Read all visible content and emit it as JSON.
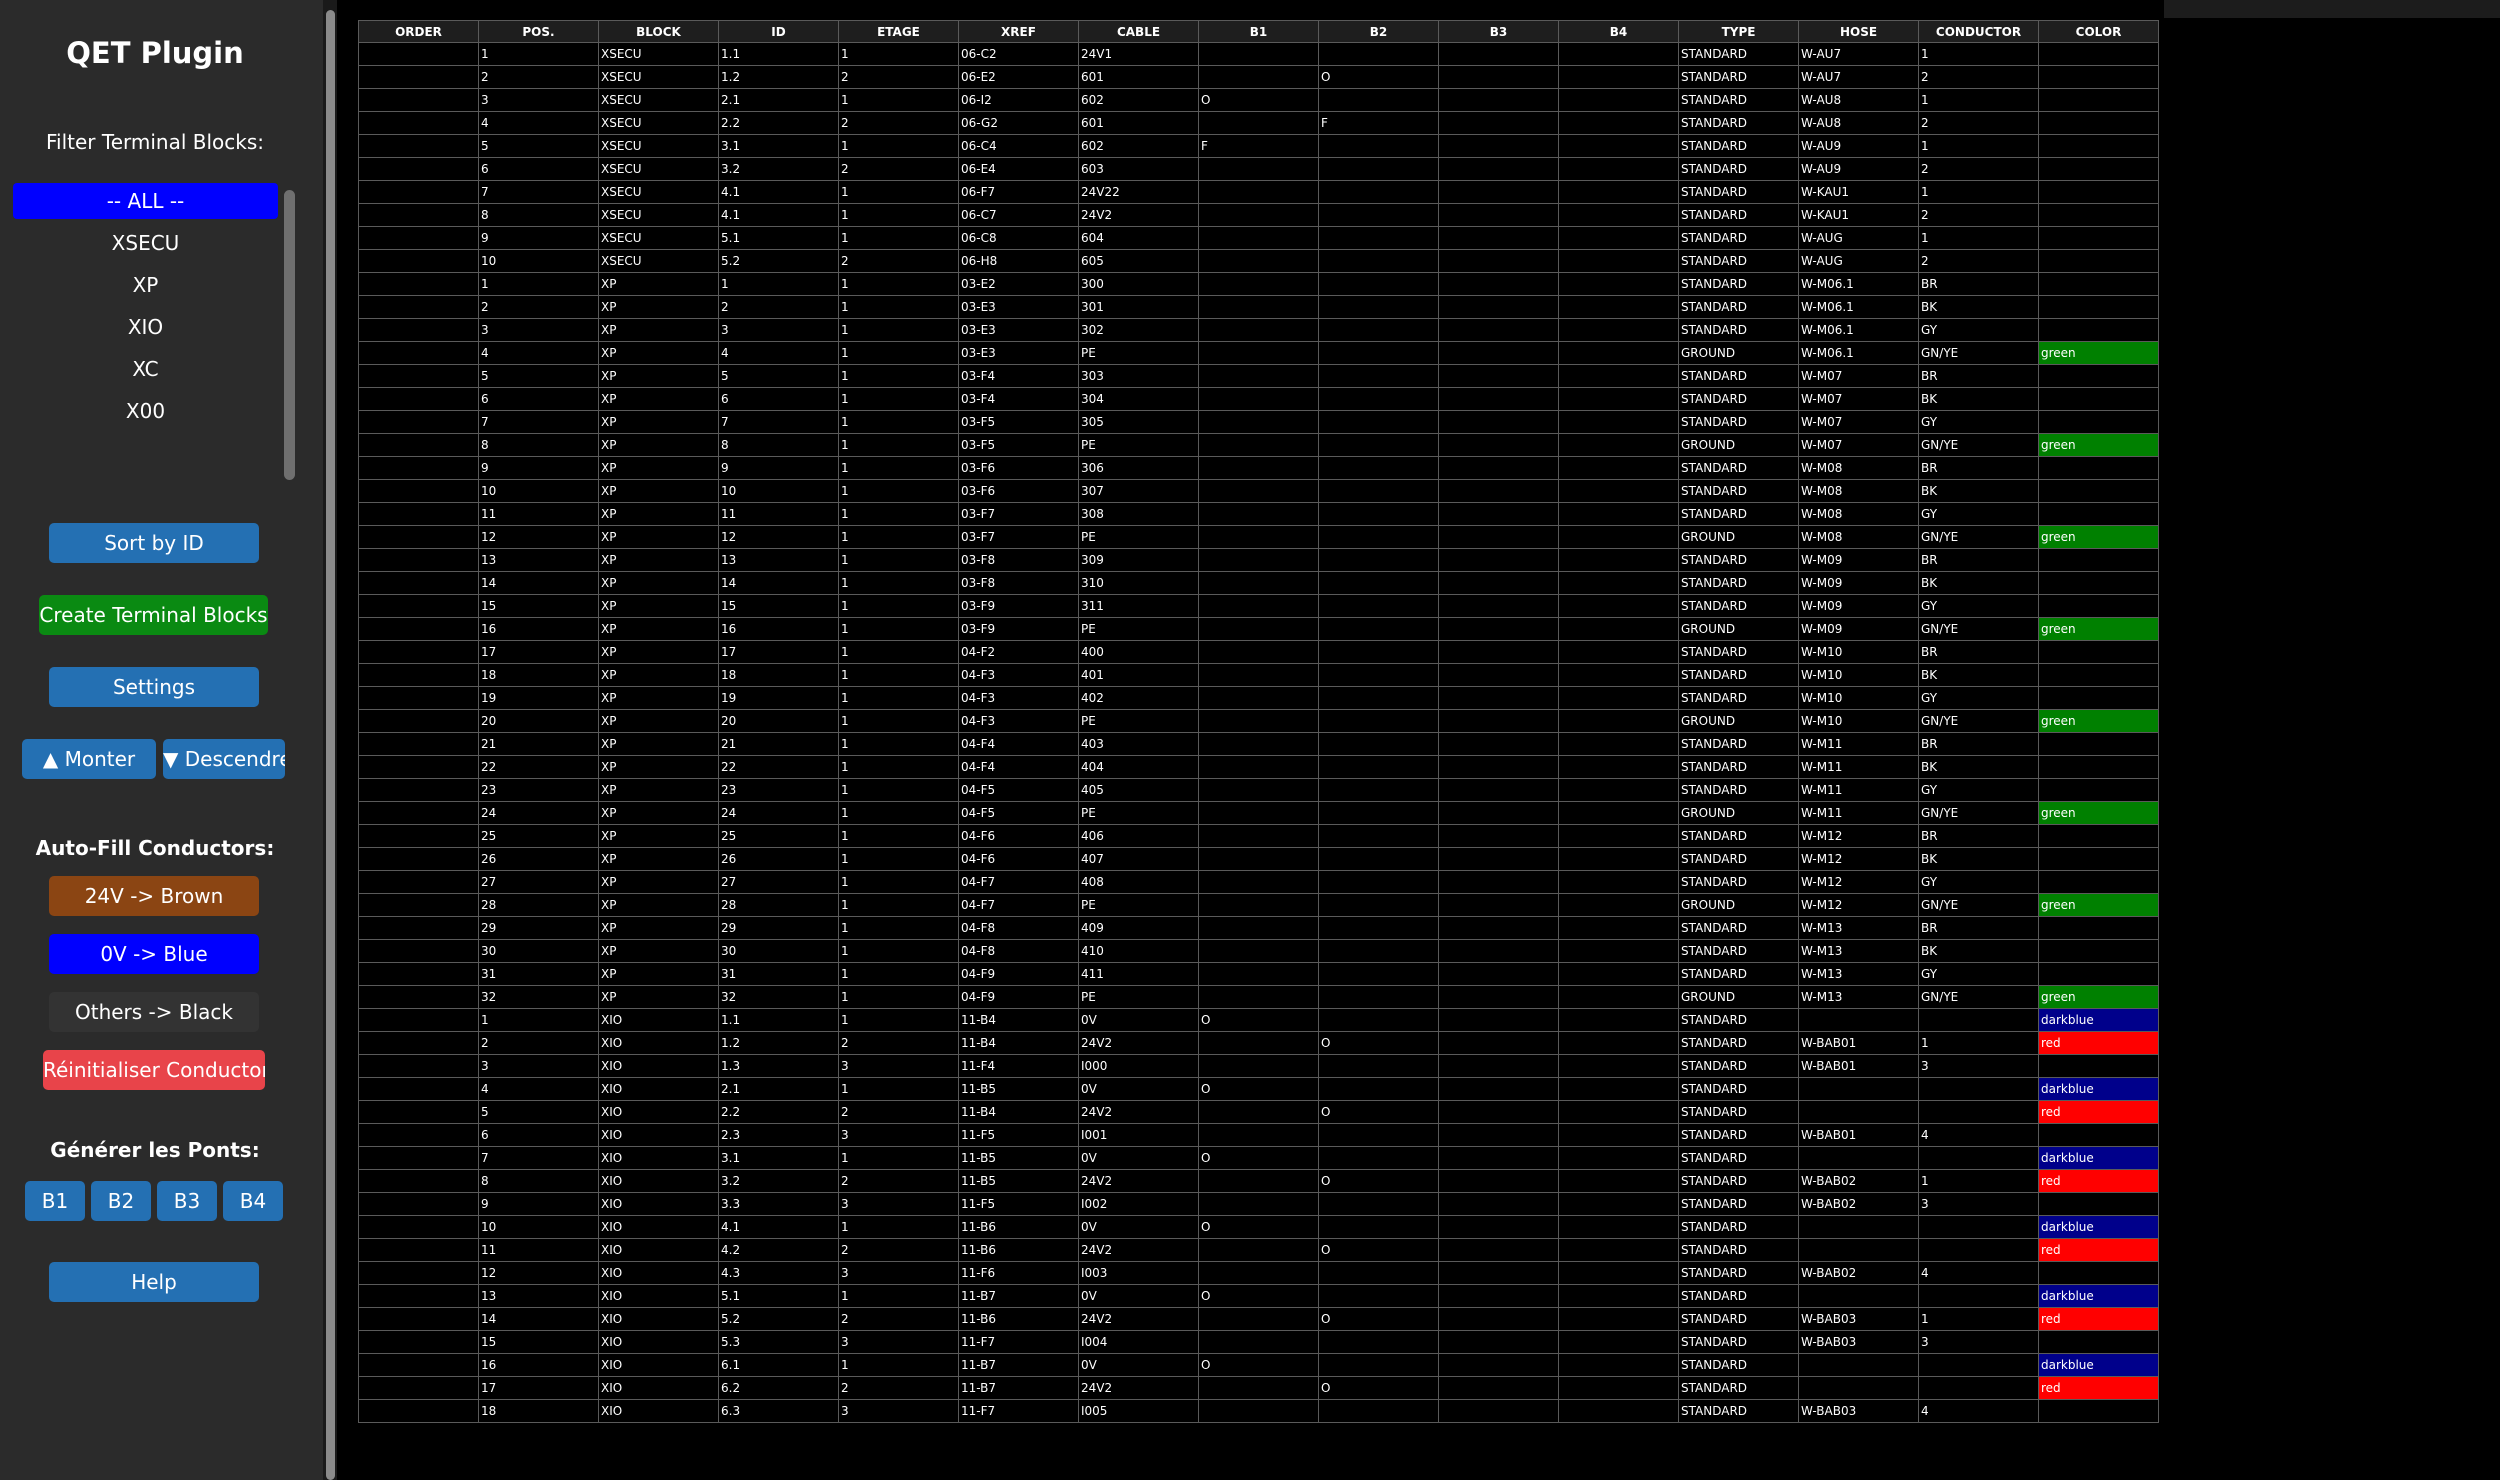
{
  "sidebar": {
    "title": "QET Plugin",
    "filter_label": "Filter Terminal Blocks:",
    "filter_items": [
      "-- ALL --",
      "XSECU",
      "XP",
      "XIO",
      "XC",
      "X00"
    ],
    "selected_filter": "-- ALL --",
    "sort_button": "Sort by ID",
    "create_button": "Create Terminal Blocks",
    "settings_button": "Settings",
    "up_button": "▲ Monter",
    "down_button": "▼ Descendre",
    "autofill_label": "Auto-Fill Conductors:",
    "autofill_24v": "24V -> Brown",
    "autofill_0v": "0V -> Blue",
    "autofill_others": "Others -> Black",
    "reset_conductor": "Réinitialiser Conductor",
    "bridges_label": "Générer les Ponts:",
    "bridge_buttons": [
      "B1",
      "B2",
      "B3",
      "B4"
    ],
    "help_button": "Help"
  },
  "colors": {
    "green": "#008000",
    "darkblue": "#00008b",
    "red": "#ff0000",
    "sidebar_bg": "#2b2b2b",
    "button_blue": "#2470b3"
  },
  "table": {
    "columns": [
      "ORDER",
      "POS.",
      "BLOCK",
      "ID",
      "ETAGE",
      "XREF",
      "CABLE",
      "B1",
      "B2",
      "B3",
      "B4",
      "TYPE",
      "HOSE",
      "CONDUCTOR",
      "COLOR"
    ],
    "rows": [
      [
        "",
        "1",
        "XSECU",
        "1.1",
        "1",
        "06-C2",
        "24V1",
        "",
        "",
        "",
        "",
        "STANDARD",
        "W-AU7",
        "1",
        ""
      ],
      [
        "",
        "2",
        "XSECU",
        "1.2",
        "2",
        "06-E2",
        "601",
        "",
        "O",
        "",
        "",
        "STANDARD",
        "W-AU7",
        "2",
        ""
      ],
      [
        "",
        "3",
        "XSECU",
        "2.1",
        "1",
        "06-I2",
        "602",
        "O",
        "",
        "",
        "",
        "STANDARD",
        "W-AU8",
        "1",
        ""
      ],
      [
        "",
        "4",
        "XSECU",
        "2.2",
        "2",
        "06-G2",
        "601",
        "",
        "F",
        "",
        "",
        "STANDARD",
        "W-AU8",
        "2",
        ""
      ],
      [
        "",
        "5",
        "XSECU",
        "3.1",
        "1",
        "06-C4",
        "602",
        "F",
        "",
        "",
        "",
        "STANDARD",
        "W-AU9",
        "1",
        ""
      ],
      [
        "",
        "6",
        "XSECU",
        "3.2",
        "2",
        "06-E4",
        "603",
        "",
        "",
        "",
        "",
        "STANDARD",
        "W-AU9",
        "2",
        ""
      ],
      [
        "",
        "7",
        "XSECU",
        "4.1",
        "1",
        "06-F7",
        "24V22",
        "",
        "",
        "",
        "",
        "STANDARD",
        "W-KAU1",
        "1",
        ""
      ],
      [
        "",
        "8",
        "XSECU",
        "4.1",
        "1",
        "06-C7",
        "24V2",
        "",
        "",
        "",
        "",
        "STANDARD",
        "W-KAU1",
        "2",
        ""
      ],
      [
        "",
        "9",
        "XSECU",
        "5.1",
        "1",
        "06-C8",
        "604",
        "",
        "",
        "",
        "",
        "STANDARD",
        "W-AUG",
        "1",
        ""
      ],
      [
        "",
        "10",
        "XSECU",
        "5.2",
        "2",
        "06-H8",
        "605",
        "",
        "",
        "",
        "",
        "STANDARD",
        "W-AUG",
        "2",
        ""
      ],
      [
        "",
        "1",
        "XP",
        "1",
        "1",
        "03-E2",
        "300",
        "",
        "",
        "",
        "",
        "STANDARD",
        "W-M06.1",
        "BR",
        ""
      ],
      [
        "",
        "2",
        "XP",
        "2",
        "1",
        "03-E3",
        "301",
        "",
        "",
        "",
        "",
        "STANDARD",
        "W-M06.1",
        "BK",
        ""
      ],
      [
        "",
        "3",
        "XP",
        "3",
        "1",
        "03-E3",
        "302",
        "",
        "",
        "",
        "",
        "STANDARD",
        "W-M06.1",
        "GY",
        ""
      ],
      [
        "",
        "4",
        "XP",
        "4",
        "1",
        "03-E3",
        "PE",
        "",
        "",
        "",
        "",
        "GROUND",
        "W-M06.1",
        "GN/YE",
        "green"
      ],
      [
        "",
        "5",
        "XP",
        "5",
        "1",
        "03-F4",
        "303",
        "",
        "",
        "",
        "",
        "STANDARD",
        "W-M07",
        "BR",
        ""
      ],
      [
        "",
        "6",
        "XP",
        "6",
        "1",
        "03-F4",
        "304",
        "",
        "",
        "",
        "",
        "STANDARD",
        "W-M07",
        "BK",
        ""
      ],
      [
        "",
        "7",
        "XP",
        "7",
        "1",
        "03-F5",
        "305",
        "",
        "",
        "",
        "",
        "STANDARD",
        "W-M07",
        "GY",
        ""
      ],
      [
        "",
        "8",
        "XP",
        "8",
        "1",
        "03-F5",
        "PE",
        "",
        "",
        "",
        "",
        "GROUND",
        "W-M07",
        "GN/YE",
        "green"
      ],
      [
        "",
        "9",
        "XP",
        "9",
        "1",
        "03-F6",
        "306",
        "",
        "",
        "",
        "",
        "STANDARD",
        "W-M08",
        "BR",
        ""
      ],
      [
        "",
        "10",
        "XP",
        "10",
        "1",
        "03-F6",
        "307",
        "",
        "",
        "",
        "",
        "STANDARD",
        "W-M08",
        "BK",
        ""
      ],
      [
        "",
        "11",
        "XP",
        "11",
        "1",
        "03-F7",
        "308",
        "",
        "",
        "",
        "",
        "STANDARD",
        "W-M08",
        "GY",
        ""
      ],
      [
        "",
        "12",
        "XP",
        "12",
        "1",
        "03-F7",
        "PE",
        "",
        "",
        "",
        "",
        "GROUND",
        "W-M08",
        "GN/YE",
        "green"
      ],
      [
        "",
        "13",
        "XP",
        "13",
        "1",
        "03-F8",
        "309",
        "",
        "",
        "",
        "",
        "STANDARD",
        "W-M09",
        "BR",
        ""
      ],
      [
        "",
        "14",
        "XP",
        "14",
        "1",
        "03-F8",
        "310",
        "",
        "",
        "",
        "",
        "STANDARD",
        "W-M09",
        "BK",
        ""
      ],
      [
        "",
        "15",
        "XP",
        "15",
        "1",
        "03-F9",
        "311",
        "",
        "",
        "",
        "",
        "STANDARD",
        "W-M09",
        "GY",
        ""
      ],
      [
        "",
        "16",
        "XP",
        "16",
        "1",
        "03-F9",
        "PE",
        "",
        "",
        "",
        "",
        "GROUND",
        "W-M09",
        "GN/YE",
        "green"
      ],
      [
        "",
        "17",
        "XP",
        "17",
        "1",
        "04-F2",
        "400",
        "",
        "",
        "",
        "",
        "STANDARD",
        "W-M10",
        "BR",
        ""
      ],
      [
        "",
        "18",
        "XP",
        "18",
        "1",
        "04-F3",
        "401",
        "",
        "",
        "",
        "",
        "STANDARD",
        "W-M10",
        "BK",
        ""
      ],
      [
        "",
        "19",
        "XP",
        "19",
        "1",
        "04-F3",
        "402",
        "",
        "",
        "",
        "",
        "STANDARD",
        "W-M10",
        "GY",
        ""
      ],
      [
        "",
        "20",
        "XP",
        "20",
        "1",
        "04-F3",
        "PE",
        "",
        "",
        "",
        "",
        "GROUND",
        "W-M10",
        "GN/YE",
        "green"
      ],
      [
        "",
        "21",
        "XP",
        "21",
        "1",
        "04-F4",
        "403",
        "",
        "",
        "",
        "",
        "STANDARD",
        "W-M11",
        "BR",
        ""
      ],
      [
        "",
        "22",
        "XP",
        "22",
        "1",
        "04-F4",
        "404",
        "",
        "",
        "",
        "",
        "STANDARD",
        "W-M11",
        "BK",
        ""
      ],
      [
        "",
        "23",
        "XP",
        "23",
        "1",
        "04-F5",
        "405",
        "",
        "",
        "",
        "",
        "STANDARD",
        "W-M11",
        "GY",
        ""
      ],
      [
        "",
        "24",
        "XP",
        "24",
        "1",
        "04-F5",
        "PE",
        "",
        "",
        "",
        "",
        "GROUND",
        "W-M11",
        "GN/YE",
        "green"
      ],
      [
        "",
        "25",
        "XP",
        "25",
        "1",
        "04-F6",
        "406",
        "",
        "",
        "",
        "",
        "STANDARD",
        "W-M12",
        "BR",
        ""
      ],
      [
        "",
        "26",
        "XP",
        "26",
        "1",
        "04-F6",
        "407",
        "",
        "",
        "",
        "",
        "STANDARD",
        "W-M12",
        "BK",
        ""
      ],
      [
        "",
        "27",
        "XP",
        "27",
        "1",
        "04-F7",
        "408",
        "",
        "",
        "",
        "",
        "STANDARD",
        "W-M12",
        "GY",
        ""
      ],
      [
        "",
        "28",
        "XP",
        "28",
        "1",
        "04-F7",
        "PE",
        "",
        "",
        "",
        "",
        "GROUND",
        "W-M12",
        "GN/YE",
        "green"
      ],
      [
        "",
        "29",
        "XP",
        "29",
        "1",
        "04-F8",
        "409",
        "",
        "",
        "",
        "",
        "STANDARD",
        "W-M13",
        "BR",
        ""
      ],
      [
        "",
        "30",
        "XP",
        "30",
        "1",
        "04-F8",
        "410",
        "",
        "",
        "",
        "",
        "STANDARD",
        "W-M13",
        "BK",
        ""
      ],
      [
        "",
        "31",
        "XP",
        "31",
        "1",
        "04-F9",
        "411",
        "",
        "",
        "",
        "",
        "STANDARD",
        "W-M13",
        "GY",
        ""
      ],
      [
        "",
        "32",
        "XP",
        "32",
        "1",
        "04-F9",
        "PE",
        "",
        "",
        "",
        "",
        "GROUND",
        "W-M13",
        "GN/YE",
        "green"
      ],
      [
        "",
        "1",
        "XIO",
        "1.1",
        "1",
        "11-B4",
        "0V",
        "O",
        "",
        "",
        "",
        "STANDARD",
        "",
        "",
        "darkblue"
      ],
      [
        "",
        "2",
        "XIO",
        "1.2",
        "2",
        "11-B4",
        "24V2",
        "",
        "O",
        "",
        "",
        "STANDARD",
        "W-BAB01",
        "1",
        "red"
      ],
      [
        "",
        "3",
        "XIO",
        "1.3",
        "3",
        "11-F4",
        "I000",
        "",
        "",
        "",
        "",
        "STANDARD",
        "W-BAB01",
        "3",
        ""
      ],
      [
        "",
        "4",
        "XIO",
        "2.1",
        "1",
        "11-B5",
        "0V",
        "O",
        "",
        "",
        "",
        "STANDARD",
        "",
        "",
        "darkblue"
      ],
      [
        "",
        "5",
        "XIO",
        "2.2",
        "2",
        "11-B4",
        "24V2",
        "",
        "O",
        "",
        "",
        "STANDARD",
        "",
        "",
        "red"
      ],
      [
        "",
        "6",
        "XIO",
        "2.3",
        "3",
        "11-F5",
        "I001",
        "",
        "",
        "",
        "",
        "STANDARD",
        "W-BAB01",
        "4",
        ""
      ],
      [
        "",
        "7",
        "XIO",
        "3.1",
        "1",
        "11-B5",
        "0V",
        "O",
        "",
        "",
        "",
        "STANDARD",
        "",
        "",
        "darkblue"
      ],
      [
        "",
        "8",
        "XIO",
        "3.2",
        "2",
        "11-B5",
        "24V2",
        "",
        "O",
        "",
        "",
        "STANDARD",
        "W-BAB02",
        "1",
        "red"
      ],
      [
        "",
        "9",
        "XIO",
        "3.3",
        "3",
        "11-F5",
        "I002",
        "",
        "",
        "",
        "",
        "STANDARD",
        "W-BAB02",
        "3",
        ""
      ],
      [
        "",
        "10",
        "XIO",
        "4.1",
        "1",
        "11-B6",
        "0V",
        "O",
        "",
        "",
        "",
        "STANDARD",
        "",
        "",
        "darkblue"
      ],
      [
        "",
        "11",
        "XIO",
        "4.2",
        "2",
        "11-B6",
        "24V2",
        "",
        "O",
        "",
        "",
        "STANDARD",
        "",
        "",
        "red"
      ],
      [
        "",
        "12",
        "XIO",
        "4.3",
        "3",
        "11-F6",
        "I003",
        "",
        "",
        "",
        "",
        "STANDARD",
        "W-BAB02",
        "4",
        ""
      ],
      [
        "",
        "13",
        "XIO",
        "5.1",
        "1",
        "11-B7",
        "0V",
        "O",
        "",
        "",
        "",
        "STANDARD",
        "",
        "",
        "darkblue"
      ],
      [
        "",
        "14",
        "XIO",
        "5.2",
        "2",
        "11-B6",
        "24V2",
        "",
        "O",
        "",
        "",
        "STANDARD",
        "W-BAB03",
        "1",
        "red"
      ],
      [
        "",
        "15",
        "XIO",
        "5.3",
        "3",
        "11-F7",
        "I004",
        "",
        "",
        "",
        "",
        "STANDARD",
        "W-BAB03",
        "3",
        ""
      ],
      [
        "",
        "16",
        "XIO",
        "6.1",
        "1",
        "11-B7",
        "0V",
        "O",
        "",
        "",
        "",
        "STANDARD",
        "",
        "",
        "darkblue"
      ],
      [
        "",
        "17",
        "XIO",
        "6.2",
        "2",
        "11-B7",
        "24V2",
        "",
        "O",
        "",
        "",
        "STANDARD",
        "",
        "",
        "red"
      ],
      [
        "",
        "18",
        "XIO",
        "6.3",
        "3",
        "11-F7",
        "I005",
        "",
        "",
        "",
        "",
        "STANDARD",
        "W-BAB03",
        "4",
        ""
      ]
    ]
  }
}
